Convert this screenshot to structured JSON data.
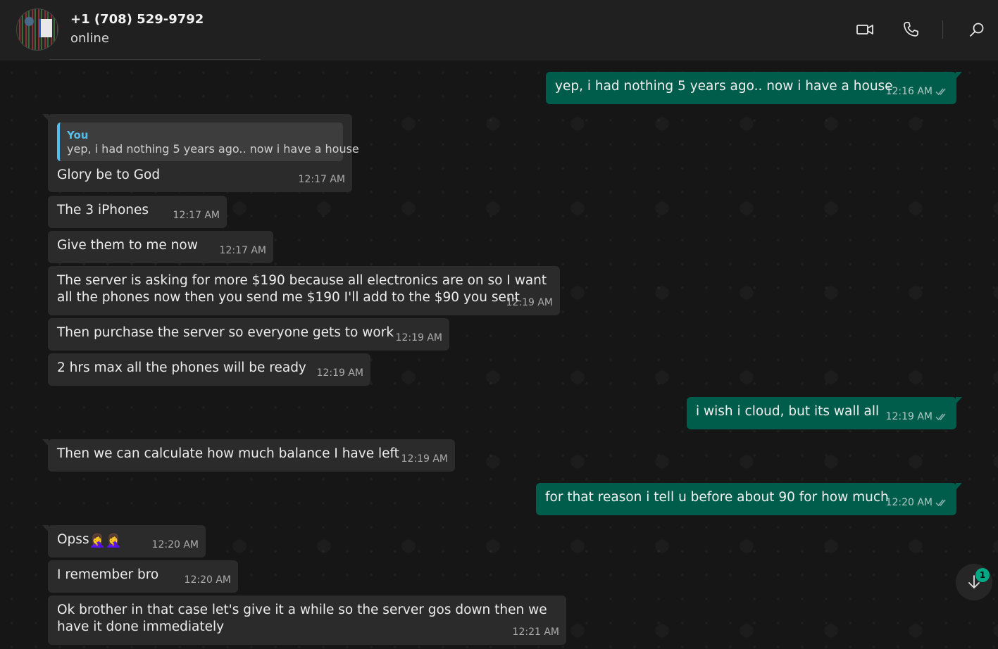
{
  "header": {
    "contact_name": "+1 (708) 529-9792",
    "status": "online",
    "icons": [
      "video-call-icon",
      "voice-call-icon",
      "search-icon"
    ]
  },
  "colors": {
    "incoming_bubble": "#2b2b2b",
    "outgoing_bubble": "#005c4b",
    "quote_accent": "#53bdeb",
    "badge": "#00a884"
  },
  "messages": [
    {
      "direction": "out",
      "text": "yep, i had nothing 5 years ago.. now i have a house",
      "time": "12:16 AM",
      "read": true
    },
    {
      "direction": "in",
      "quote": {
        "author": "You",
        "text": "yep, i had nothing 5 years ago.. now i have a house"
      },
      "text": "Glory be to God",
      "time": "12:17 AM"
    },
    {
      "direction": "in",
      "text": "The 3 iPhones",
      "time": "12:17 AM"
    },
    {
      "direction": "in",
      "text": "Give them to me now",
      "time": "12:17 AM"
    },
    {
      "direction": "in",
      "text": "The server is asking for more $190 because all electronics are on so I want all the phones now then you send me $190 I'll add to the $90 you sent",
      "time": "12:19 AM"
    },
    {
      "direction": "in",
      "text": "Then purchase the server so everyone gets to work",
      "time": "12:19 AM"
    },
    {
      "direction": "in",
      "text": "2 hrs max all the phones will be ready",
      "time": "12:19 AM"
    },
    {
      "direction": "out",
      "text": "i wish i cloud, but its wall all",
      "time": "12:19 AM",
      "read": true
    },
    {
      "direction": "in",
      "text": "Then we can calculate how much balance I have left",
      "time": "12:19 AM"
    },
    {
      "direction": "out",
      "text": "for that reason i tell u before about 90 for how much",
      "time": "12:20 AM",
      "read": true
    },
    {
      "direction": "in",
      "text": "Opss",
      "emoji": "🤦‍♀️🤦‍♀️",
      "time": "12:20 AM"
    },
    {
      "direction": "in",
      "text": "I remember bro",
      "time": "12:20 AM"
    },
    {
      "direction": "in",
      "text": "Ok brother in that case let's give it a while so the server gos down then we have it done immediately",
      "time": "12:21 AM"
    }
  ],
  "scroll_down": {
    "unread_count": "1"
  }
}
